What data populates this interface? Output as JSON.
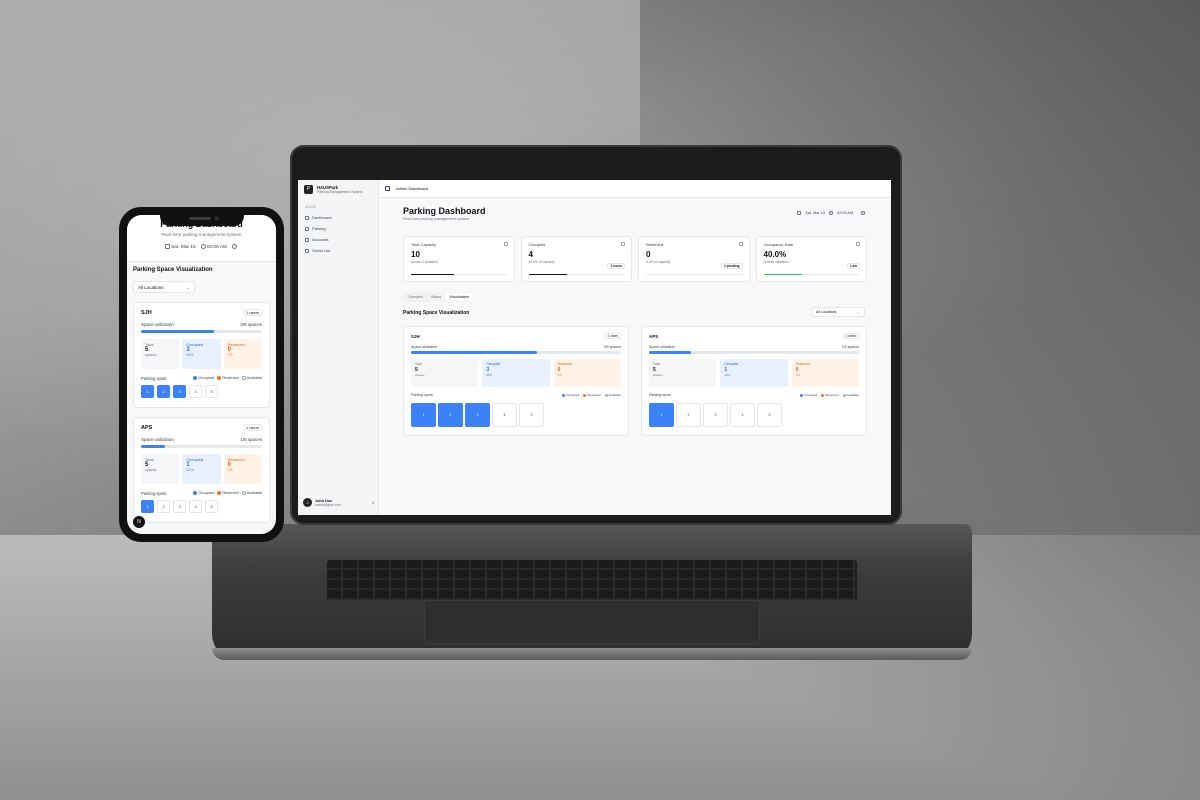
{
  "colors": {
    "accent": "#3b82f6",
    "occupied": "#3b82f6",
    "reserved": "#f97316",
    "available": "#ffffff"
  },
  "desktop": {
    "app_name": "HAUSPark",
    "app_subtitle": "Parking Management System",
    "sidebar": {
      "section_label": "ADMIN",
      "items": [
        {
          "label": "Dashboard",
          "icon": "grid-icon"
        },
        {
          "label": "Parking",
          "icon": "parking-icon"
        },
        {
          "label": "Accounts",
          "icon": "users-icon"
        },
        {
          "label": "Guest List",
          "icon": "list-icon"
        }
      ],
      "user": {
        "name": "John Doe",
        "email": "admin@gosi.com",
        "initial": "J"
      }
    },
    "topbar": {
      "breadcrumb": "Admin Dashboard"
    },
    "header": {
      "title": "Parking Dashboard",
      "subtitle": "Real-time parking management system",
      "date": "Sat, Mar 15",
      "time": "02:03 AM"
    },
    "cards": [
      {
        "label": "Total Capacity",
        "value": "10",
        "note": "Across 2 locations",
        "badge": "",
        "progress": 0.45
      },
      {
        "label": "Occupied",
        "value": "4",
        "note": "40.0% of capacity",
        "badge": "1 users",
        "progress": 0.4
      },
      {
        "label": "Reserved",
        "value": "0",
        "note": "0.0% of capacity",
        "badge": "1 pending",
        "progress": 0
      },
      {
        "label": "Occupancy Rate",
        "value": "40.0%",
        "note": "Overall utilization",
        "badge": "Low",
        "progress": 0.4
      }
    ],
    "tabs": [
      "Overview",
      "Status",
      "Visualization"
    ],
    "active_tab": "Visualization",
    "viz_title": "Parking Space Visualization",
    "location_filter": "All Locations",
    "legend": {
      "occupied": "Occupied",
      "reserved": "Reserved",
      "available": "Available"
    },
    "spots_label": "Parking spots",
    "locations": [
      {
        "name": "SJH",
        "badge": "1 users",
        "util_label": "Space utilization",
        "util_value": "3/5 spaces",
        "util": 0.6,
        "total_label": "Total",
        "total": "5",
        "total_note": "spaces",
        "occ_label": "Occupied",
        "occ": "3",
        "occ_note": "60%",
        "res_label": "Reserved",
        "res": "0",
        "res_note": "0%",
        "spots": [
          {
            "n": "1",
            "occ": true
          },
          {
            "n": "2",
            "occ": true
          },
          {
            "n": "3",
            "occ": true
          },
          {
            "n": "4",
            "occ": false
          },
          {
            "n": "5",
            "occ": false
          }
        ]
      },
      {
        "name": "APS",
        "badge": "1 users",
        "util_label": "Space utilization",
        "util_value": "1/5 spaces",
        "util": 0.2,
        "total_label": "Total",
        "total": "5",
        "total_note": "spaces",
        "occ_label": "Occupied",
        "occ": "1",
        "occ_note": "20%",
        "res_label": "Reserved",
        "res": "0",
        "res_note": "0%",
        "spots": [
          {
            "n": "1",
            "occ": true
          },
          {
            "n": "2",
            "occ": false
          },
          {
            "n": "3",
            "occ": false
          },
          {
            "n": "4",
            "occ": false
          },
          {
            "n": "5",
            "occ": false
          }
        ]
      }
    ]
  },
  "mobile": {
    "title": "Parking Dashboard",
    "subtitle": "Real-time parking management system",
    "date": "Sat, Mar 15",
    "time": "02:06 AM",
    "viz_title": "Parking Space Visualization",
    "location_filter": "All Locations",
    "spots_label": "Parking spots",
    "legend": {
      "occupied": "Occupied",
      "reserved": "Reserved",
      "available": "Available"
    },
    "fab": "N",
    "locations": [
      {
        "name": "SJH",
        "badge": "1 users",
        "util_label": "Space utilization",
        "util_value": "3/5 spaces",
        "util": 0.6,
        "total_label": "Total",
        "total": "5",
        "total_note": "spaces",
        "occ_label": "Occupied",
        "occ": "3",
        "occ_note": "60%",
        "res_label": "Reserved",
        "res": "0",
        "res_note": "0%",
        "spots": [
          {
            "n": "1",
            "occ": true
          },
          {
            "n": "2",
            "occ": true
          },
          {
            "n": "3",
            "occ": true
          },
          {
            "n": "4",
            "occ": false
          },
          {
            "n": "5",
            "occ": false
          }
        ]
      },
      {
        "name": "APS",
        "badge": "1 users",
        "util_label": "Space utilization",
        "util_value": "1/5 spaces",
        "util": 0.2,
        "total_label": "Total",
        "total": "5",
        "total_note": "spaces",
        "occ_label": "Occupied",
        "occ": "1",
        "occ_note": "20%",
        "res_label": "Reserved",
        "res": "0",
        "res_note": "0%",
        "spots": [
          {
            "n": "1",
            "occ": true
          },
          {
            "n": "2",
            "occ": false
          },
          {
            "n": "3",
            "occ": false
          },
          {
            "n": "4",
            "occ": false
          },
          {
            "n": "5",
            "occ": false
          }
        ]
      }
    ]
  }
}
